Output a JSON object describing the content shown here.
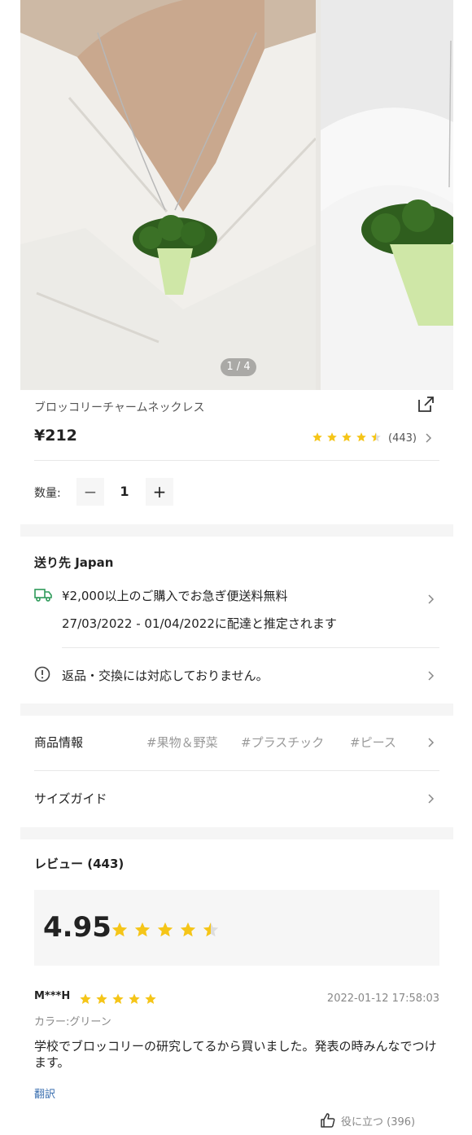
{
  "gallery": {
    "counter": "1 / 4"
  },
  "product": {
    "title": "ブロッコリーチャームネックレス",
    "price": "¥212",
    "rating_stars": 4.5,
    "rating_count": "(443)"
  },
  "quantity": {
    "label": "数量:",
    "value": "1",
    "minus": "−",
    "plus": "+"
  },
  "shipping": {
    "title": "送り先 Japan",
    "free_shipping": "¥2,000以上のご購入でお急ぎ便送料無料",
    "delivery": "27/03/2022 - 01/04/2022に配達と推定されます",
    "returns": "返品・交換には対応しておりません。"
  },
  "info": {
    "label": "商品情報",
    "tags": [
      "#果物＆野菜",
      "#プラスチック",
      "#ピース"
    ],
    "size_guide": "サイズガイド"
  },
  "reviews": {
    "title": "レビュー (443)",
    "score": "4.95",
    "score_stars": 4.5,
    "items": [
      {
        "user": "M***H",
        "stars": 5,
        "date": "2022-01-12 17:58:03",
        "color": "カラー:グリーン",
        "text": "学校でブロッコリーの研究してるから買いました。発表の時みんなでつけます。",
        "translate": "翻訳",
        "helpful": "役に立つ (396)"
      }
    ]
  },
  "colors": {
    "star": "#f5c518",
    "accent_link": "#3a6fb0",
    "band": "#f5f5f5"
  },
  "icons": [
    "share-icon",
    "star-icon",
    "chevron-right-icon",
    "truck-icon",
    "alert-circle-icon",
    "thumbs-up-icon"
  ]
}
